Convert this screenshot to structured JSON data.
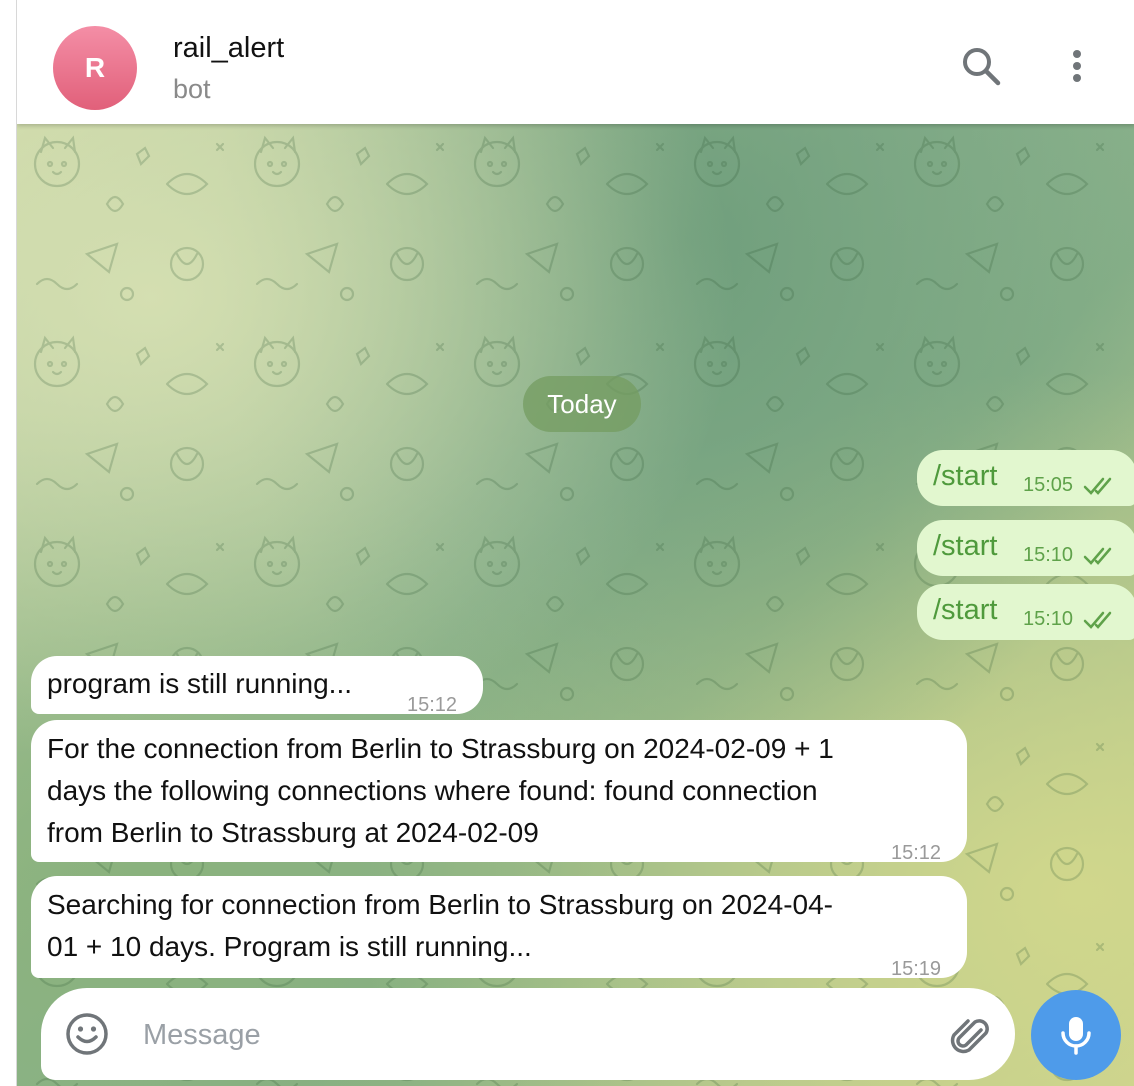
{
  "header": {
    "avatar_letter": "R",
    "title": "rail_alert",
    "subtitle": "bot"
  },
  "chat": {
    "date_label": "Today",
    "outgoing": [
      {
        "text": "/start",
        "time": "15:05"
      },
      {
        "text": "/start",
        "time": "15:10"
      },
      {
        "text": "/start",
        "time": "15:10"
      }
    ],
    "incoming": [
      {
        "text": "program is still running...",
        "time": "15:12"
      },
      {
        "text": "For the connection from Berlin to Strassburg on 2024-02-09 + 1\ndays the following connections where found: found connection\nfrom Berlin to Strassburg at 2024-02-09",
        "time": "15:12"
      },
      {
        "text": "Searching for connection from Berlin to Strassburg on 2024-04-\n01 + 10 days. Program is still running...",
        "time": "15:19"
      }
    ]
  },
  "composer": {
    "placeholder": "Message"
  },
  "colors": {
    "avatar": "#e96f88",
    "outgoing_bubble": "#e2f7cf",
    "outgoing_text": "#4f9a3c",
    "mic_button": "#4e9bea"
  },
  "icons": [
    "search-icon",
    "more-vert-icon",
    "double-check-icon",
    "emoji-icon",
    "attach-icon",
    "mic-icon"
  ]
}
